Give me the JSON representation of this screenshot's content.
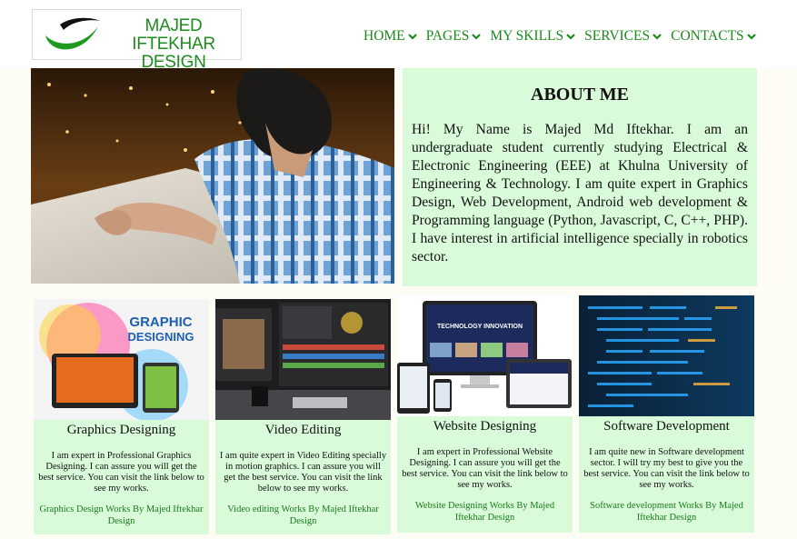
{
  "header": {
    "logo_line1": "MAJED IFTEKHAR",
    "logo_line2": "DESIGN",
    "nav": [
      {
        "label": "HOME"
      },
      {
        "label": "PAGES"
      },
      {
        "label": "MY SKILLS"
      },
      {
        "label": "SERVICES"
      },
      {
        "label": "CONTACTS"
      }
    ]
  },
  "about": {
    "title": "ABOUT ME",
    "text": "Hi! My Name is Majed Md Iftekhar. I am an undergraduate student currently studying Electrical & Electronic Engineering (EEE) at Khulna University of Engineering & Technology. I am quite expert in Graphics Design, Web Development, Android web development & Programming language (Python, Javascript, C, C++, PHP). I have interest in artificial intelligence specially in robotics sector."
  },
  "cards": [
    {
      "image_text": "GRAPHIC DESIGNING",
      "title": "Graphics Designing",
      "desc": "I am expert in Professional Graphics Designing. I can assure you will get the best service. You can visit the link below to see my works.",
      "link": "Graphics Design Works By Majed Iftekhar Design"
    },
    {
      "title": "Video Editing",
      "desc": "I am quite expert in Video Editing specially in motion graphics. I can assure you will get the best service. You can visit the link below to see my works.",
      "link": "Video editing Works By Majed Iftekhar Design"
    },
    {
      "image_text": "TECHNOLOGY INNOVATION",
      "title": "Website Designing",
      "desc": "I am expert in Professional Website Designing. I can assure you will get the best service. You can visit the link below to see my works.",
      "link": "Website Designing Works By Majed Iftekhar Design"
    },
    {
      "title": "Software Development",
      "desc": "I am quite new in Software development sector. I will try my best to give you the best service. You can visit the link below to see my works.",
      "link": "Software development Works By Majed Iftekhar Design"
    }
  ],
  "colors": {
    "brand_green": "#1a8a1a",
    "panel_bg": "#d9fbd9",
    "page_bg": "#fdfdf5"
  }
}
